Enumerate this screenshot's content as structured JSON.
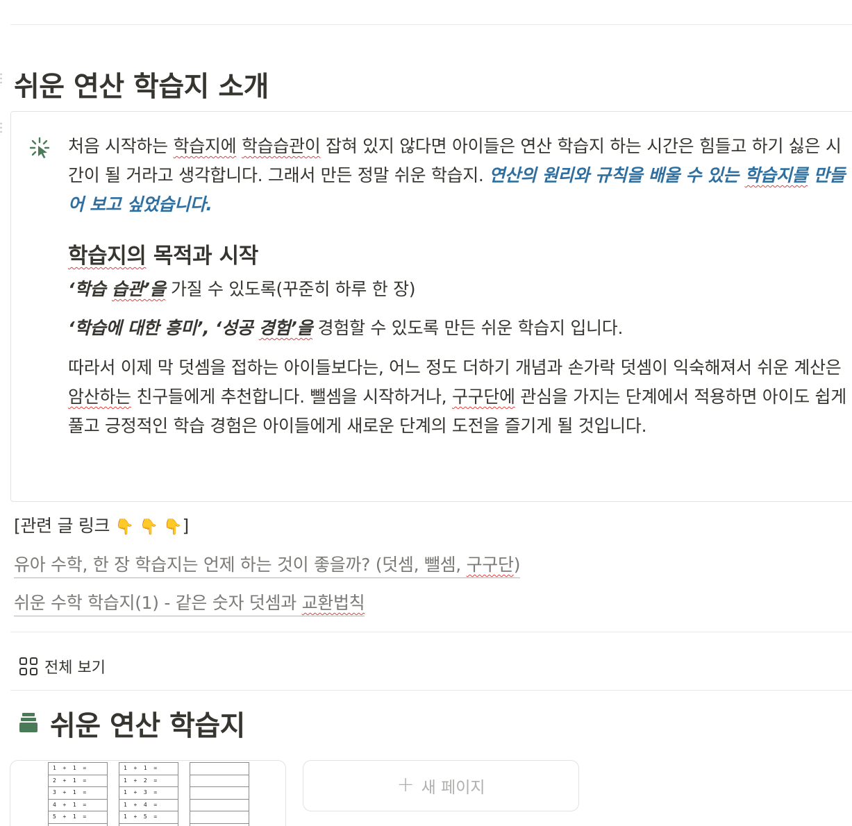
{
  "page": {
    "title": "쉬운 연산 학습지 소개"
  },
  "callout": {
    "icon": "sparkle-cursor-icon",
    "intro_part1": "처음 시작하는 ",
    "intro_sq1": "학습지에",
    "intro_part2": " ",
    "intro_sq2": "학습습관이",
    "intro_part3": " 잡혀 있지 않다면 아이들은 연산 학습지 하는 시간은 힘들고 하기 싫은 시간이 될 거라고 생각합니다. 그래서 만든 정말 쉬운 학습지. ",
    "intro_emphasis1": "연산의 원리와 규칙을 배울 수 있는 ",
    "intro_emphasis_sq": "학습지를",
    "intro_emphasis2": " 만들어 보고 싶었습니다.",
    "heading_sq": "학습지의",
    "heading_rest": " 목적과 시작",
    "line1_bold_a": "‘학습 ",
    "line1_bold_sq": "습관’을",
    "line1_rest": " 가질 수 있도록(꾸준히 하루 한 장)",
    "line2_bold_a": "‘학습에 대한 흥미’, ‘성공 ",
    "line2_bold_sq": "경험’을",
    "line2_rest": " 경험할 수 있도록 만든 쉬운 학습지 입니다.",
    "last_part1": "따라서 이제 막 덧셈을 접하는 아이들보다는, 어느 정도 더하기 개념과 손가락 덧셈이 익숙해져서 쉬운 계산은 ",
    "last_sq1": "암산하는",
    "last_part2": " 친구들에게 추천합니다.  뺄셈을 시작하거나, ",
    "last_sq2": "구구단에",
    "last_part3": " 관심을 가지는 단계에서 적용하면 아이도 쉽게 풀고 긍정적인 학습 경험은 아이들에게 새로운 단계의 도전을 즐기게 될 것입니다."
  },
  "related": {
    "label_open": "[관련 글 링크 ",
    "pointer_icon": "👇",
    "label_close": "]"
  },
  "links": {
    "link1_main": "유아 수학, 한 장 학습지는 언제 하는 것이 좋을까? (덧셈, 뺄셈, ",
    "link1_sq": "구구단",
    "link1_end": ")",
    "link2_main": "쉬운 수학 학습지(1) - 같은 숫자 덧셈과 ",
    "link2_sq": "교환법칙"
  },
  "view": {
    "icon": "gallery-grid-icon",
    "label": "전체 보기"
  },
  "database": {
    "icon": "books-stack-icon",
    "title": "쉬운 연산 학습지",
    "sheet1_rows": [
      "1  +  1  =",
      "2  +  1  =",
      "3  +  1  =",
      "4  +  1  =",
      "5  +  1  ="
    ],
    "sheet2_rows": [
      "1  +  1  =",
      "1  +  2  =",
      "1  +  3  =",
      "1  +  4  =",
      "1  +  5  ="
    ],
    "new_page_label": "새 페이지"
  }
}
